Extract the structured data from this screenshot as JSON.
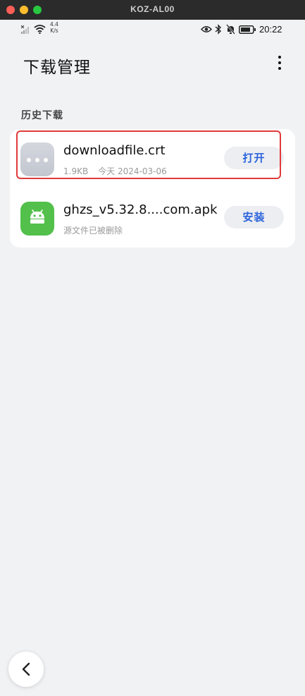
{
  "window": {
    "title": "KOZ-AL00"
  },
  "statusbar": {
    "net_speed_value": "4.4",
    "net_speed_unit": "K/s",
    "time": "20:22"
  },
  "header": {
    "title": "下载管理",
    "more_icon": "more-vert-icon"
  },
  "section": {
    "title": "历史下载"
  },
  "downloads": [
    {
      "icon": "generic-file-icon",
      "name": "downloadfile.crt",
      "size": "1.9KB",
      "date": "今天 2024-03-06",
      "action": "打开"
    },
    {
      "icon": "android-apk-icon",
      "name": "ghzs_v5.32.8....com.apk",
      "status": "源文件已被删除",
      "action": "安装"
    }
  ],
  "colors": {
    "accent": "#2b63dc",
    "highlight": "#e03a3a",
    "apk_green": "#52c04b",
    "background": "#f1f2f4"
  }
}
